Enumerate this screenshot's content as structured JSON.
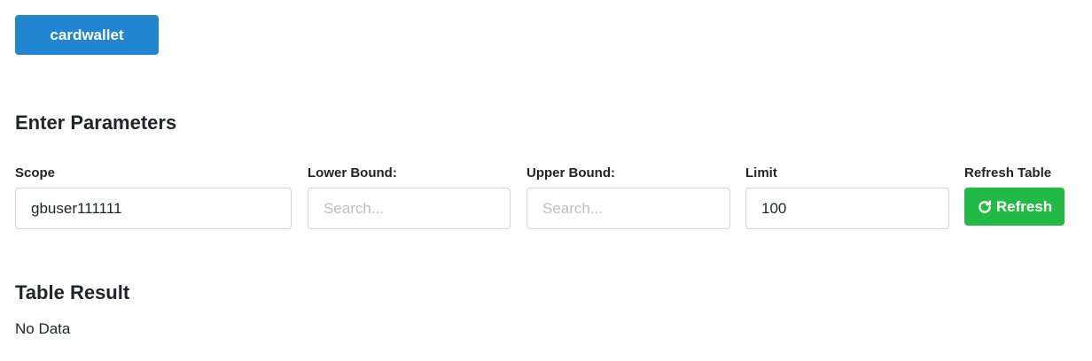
{
  "table_button": {
    "label": "cardwallet"
  },
  "params": {
    "title": "Enter Parameters",
    "scope": {
      "label": "Scope",
      "value": "gbuser111111",
      "placeholder": ""
    },
    "lower_bound": {
      "label": "Lower Bound:",
      "value": "",
      "placeholder": "Search..."
    },
    "upper_bound": {
      "label": "Upper Bound:",
      "value": "",
      "placeholder": "Search..."
    },
    "limit": {
      "label": "Limit",
      "value": "100",
      "placeholder": ""
    },
    "refresh": {
      "label": "Refresh Table",
      "button_label": "Refresh",
      "icon": "refresh-icon"
    }
  },
  "result": {
    "title": "Table Result",
    "empty_text": "No Data"
  },
  "colors": {
    "primary": "#2185d0",
    "positive": "#21ba45",
    "text": "#212529",
    "placeholder": "#bdbdbd"
  }
}
